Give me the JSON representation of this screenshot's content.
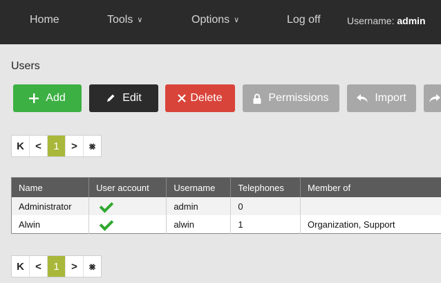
{
  "nav": {
    "home": "Home",
    "tools": "Tools",
    "options": "Options",
    "logoff": "Log off",
    "username_label": "Username:",
    "username_value": "admin"
  },
  "page": {
    "title": "Users"
  },
  "toolbar": {
    "add": "Add",
    "edit": "Edit",
    "delete": "Delete",
    "permissions": "Permissions",
    "import": "Import",
    "colors": {
      "add": "#3cb043",
      "edit": "#2b2b2b",
      "delete": "#d9443a",
      "disabled": "#a8a8a8"
    }
  },
  "pager": {
    "first": "K",
    "prev": "<",
    "current": "1",
    "next": ">",
    "last": "⨳",
    "active_color": "#a9b83a"
  },
  "table": {
    "headers": [
      "Name",
      "User account",
      "Username",
      "Telephones",
      "Member of"
    ],
    "rows": [
      {
        "name": "Administrator",
        "user_account": "check-icon",
        "username": "admin",
        "telephones": "0",
        "member_of": ""
      },
      {
        "name": "Alwin",
        "user_account": "check-icon",
        "username": "alwin",
        "telephones": "1",
        "member_of": "Organization, Support"
      }
    ]
  }
}
